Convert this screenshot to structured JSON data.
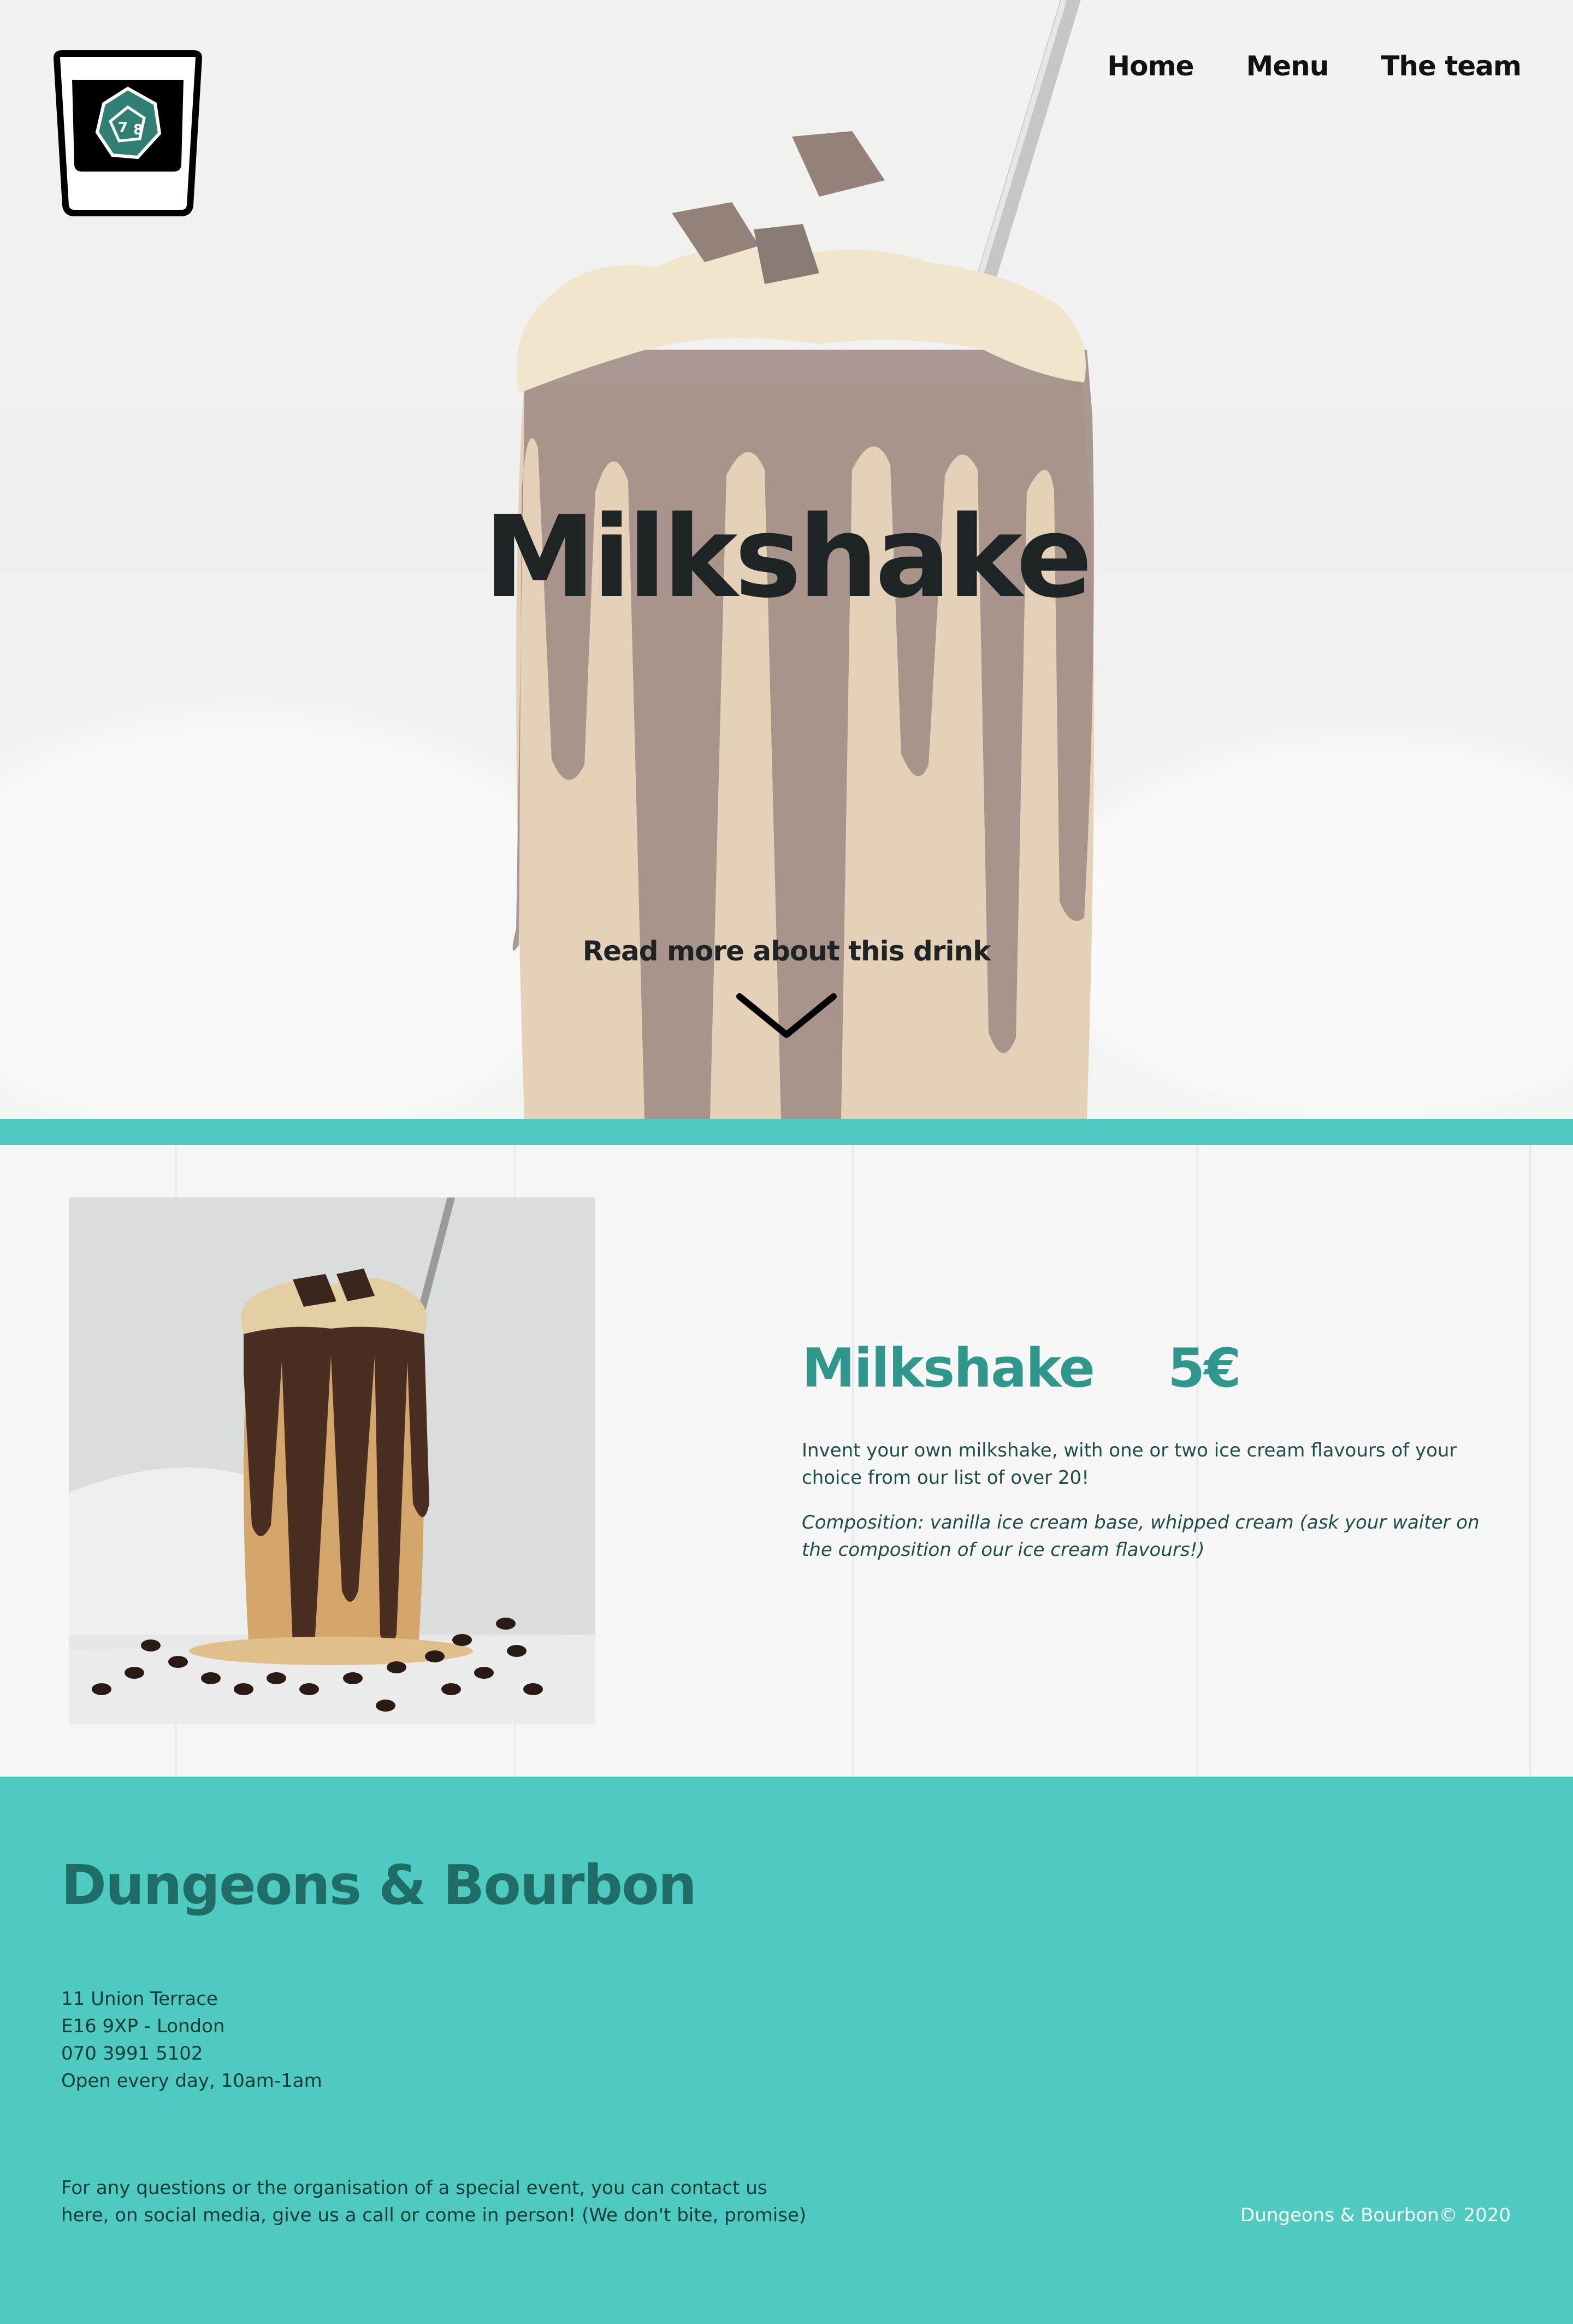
{
  "brand": {
    "name": "Dungeons & Bourbon"
  },
  "nav": {
    "items": [
      {
        "label": "Home"
      },
      {
        "label": "Menu"
      },
      {
        "label": "The team"
      }
    ]
  },
  "hero": {
    "title": "Milkshake",
    "read_more": "Read more about this drink"
  },
  "product": {
    "name": "Milkshake",
    "price": "5€",
    "description": "Invent your own milkshake, with one or two ice cream flavours of your choice from our list of over 20!",
    "composition": "Composition: vanilla ice cream base, whipped cream (ask your waiter on the composition of our ice cream flavours!)"
  },
  "footer": {
    "title": "Dungeons & Bourbon",
    "address": [
      "11 Union Terrace",
      "E16 9XP - London",
      "070 3991 5102",
      "Open every day, 10am-1am"
    ],
    "contact": "For any questions or the organisation of a special event, you can contact us here, on social media, give us a call or come in person! (We don't bite, promise)",
    "copyright": "Dungeons & Bourbon© 2020"
  },
  "colors": {
    "teal": "#4ecac0",
    "teal_dark": "#2f978b",
    "footer_title": "#1f6d66",
    "text_dark": "#1e2325"
  },
  "icons": {
    "logo": "whiskey-glass-dice-icon",
    "scroll": "chevron-down-icon"
  }
}
